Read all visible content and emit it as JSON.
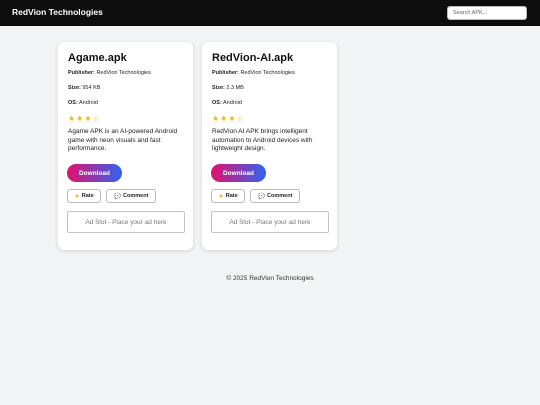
{
  "header": {
    "brand": "RedVion Technologies",
    "search_placeholder": "Search APK..."
  },
  "labels": {
    "publisher": "Publisher:",
    "size": "Size:",
    "os": "OS:"
  },
  "cards": [
    {
      "title": "Agame.apk",
      "publisher": "RedVion Technologies",
      "size": "954 KB",
      "os": "Android",
      "stars": "★★★☆",
      "rating": {
        "filled": 3,
        "total": 4
      },
      "description": "Agame APK is an AI-powered Android game with neon visuals and fast performance.",
      "download_label": "Download",
      "rate_label": "Rate",
      "comment_label": "Comment",
      "ad_text": "Ad Slot - Place your ad here"
    },
    {
      "title": "RedVion-AI.apk",
      "publisher": "RedVion Technologies",
      "size": "2.3 MB",
      "os": "Android",
      "stars": "★★★☆",
      "rating": {
        "filled": 3,
        "total": 4
      },
      "description": "RedVion AI APK brings intelligent automation to Android devices with lightweight design.",
      "download_label": "Download",
      "rate_label": "Rate",
      "comment_label": "Comment",
      "ad_text": "Ad Slot - Place your ad here"
    }
  ],
  "icons": {
    "rate": "star-icon",
    "comment": "speech-bubble-icon"
  },
  "colors": {
    "topbar": "#0d0d0d",
    "download_gradient_start": "#e3106e",
    "download_gradient_end": "#2f64f0",
    "star": "#f5b301"
  },
  "footer": {
    "text": "© 2025 RedVion Technologies"
  }
}
